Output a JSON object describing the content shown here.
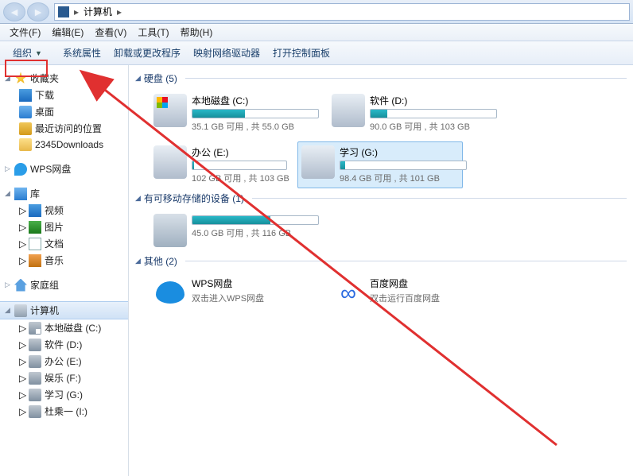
{
  "titlebar": {
    "crumb": "计算机"
  },
  "menubar": {
    "file": "文件(F)",
    "edit": "编辑(E)",
    "view": "查看(V)",
    "tools": "工具(T)",
    "help": "帮助(H)"
  },
  "toolbar": {
    "organize": "组织",
    "props": "系统属性",
    "uninstall": "卸载或更改程序",
    "mapnet": "映射网络驱动器",
    "cp": "打开控制面板"
  },
  "sidebar": {
    "fav": {
      "label": "收藏夹",
      "items": [
        "下载",
        "桌面",
        "最近访问的位置",
        "2345Downloads"
      ]
    },
    "wps": {
      "label": "WPS网盘"
    },
    "lib": {
      "label": "库",
      "items": [
        "视频",
        "图片",
        "文档",
        "音乐"
      ]
    },
    "home": {
      "label": "家庭组"
    },
    "pc": {
      "label": "计算机",
      "items": [
        "本地磁盘 (C:)",
        "软件 (D:)",
        "办公 (E:)",
        "娱乐 (F:)",
        "学习 (G:)",
        "杜乘一 (I:)"
      ]
    }
  },
  "groups": {
    "hdd": {
      "label": "硬盘 (5)"
    },
    "remov": {
      "label": "有可移动存储的设备 (1)"
    },
    "other": {
      "label": "其他 (2)"
    }
  },
  "drives": {
    "c": {
      "name": "本地磁盘 (C:)",
      "stat": "35.1 GB 可用 , 共 55.0 GB",
      "fill": 42
    },
    "d": {
      "name": "软件 (D:)",
      "stat": "90.0 GB 可用 , 共 103 GB",
      "fill": 13
    },
    "e": {
      "name": "办公 (E:)",
      "stat": "102 GB 可用 , 共 103 GB",
      "fill": 2
    },
    "g": {
      "name": "学习 (G:)",
      "stat": "98.4 GB 可用 , 共 101 GB",
      "fill": 4
    },
    "r": {
      "name": "",
      "stat": "45.0 GB 可用 , 共 116 GB",
      "fill": 62
    },
    "wps": {
      "name": "WPS网盘",
      "sub": "双击进入WPS网盘"
    },
    "baidu": {
      "name": "百度网盘",
      "sub": "双击运行百度网盘"
    }
  }
}
